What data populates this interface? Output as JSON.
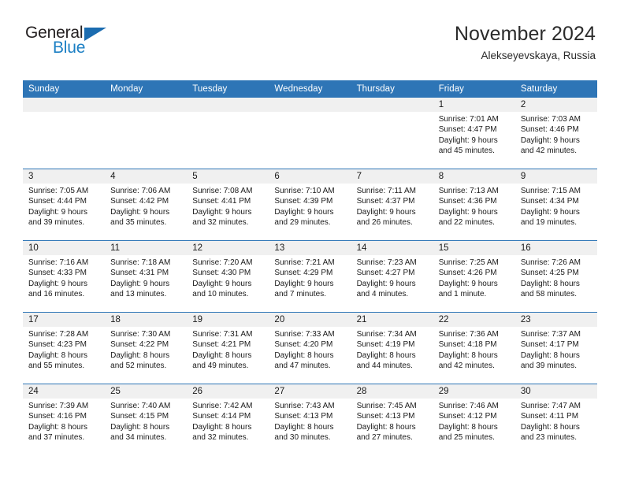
{
  "logo": {
    "word1": "General",
    "word2": "Blue",
    "triangle_icon": "triangle-icon",
    "color_dark": "#231f20",
    "color_blue": "#1b7fc4"
  },
  "header": {
    "title": "November 2024",
    "subtitle": "Alekseyevskaya, Russia"
  },
  "colors": {
    "header_bar": "#2e75b6",
    "daynum_strip": "#f0f0f0",
    "cell_bg": "#ffffff",
    "text": "#1a1a1a"
  },
  "weekdays": [
    "Sunday",
    "Monday",
    "Tuesday",
    "Wednesday",
    "Thursday",
    "Friday",
    "Saturday"
  ],
  "labels": {
    "sunrise": "Sunrise:",
    "sunset": "Sunset:",
    "daylight": "Daylight:"
  },
  "weeks": [
    [
      {
        "day": "",
        "sunrise": "",
        "sunset": "",
        "daylight1": "",
        "daylight2": "",
        "empty": true
      },
      {
        "day": "",
        "sunrise": "",
        "sunset": "",
        "daylight1": "",
        "daylight2": "",
        "empty": true
      },
      {
        "day": "",
        "sunrise": "",
        "sunset": "",
        "daylight1": "",
        "daylight2": "",
        "empty": true
      },
      {
        "day": "",
        "sunrise": "",
        "sunset": "",
        "daylight1": "",
        "daylight2": "",
        "empty": true
      },
      {
        "day": "",
        "sunrise": "",
        "sunset": "",
        "daylight1": "",
        "daylight2": "",
        "empty": true
      },
      {
        "day": "1",
        "sunrise": "Sunrise: 7:01 AM",
        "sunset": "Sunset: 4:47 PM",
        "daylight1": "Daylight: 9 hours",
        "daylight2": "and 45 minutes.",
        "empty": false
      },
      {
        "day": "2",
        "sunrise": "Sunrise: 7:03 AM",
        "sunset": "Sunset: 4:46 PM",
        "daylight1": "Daylight: 9 hours",
        "daylight2": "and 42 minutes.",
        "empty": false
      }
    ],
    [
      {
        "day": "3",
        "sunrise": "Sunrise: 7:05 AM",
        "sunset": "Sunset: 4:44 PM",
        "daylight1": "Daylight: 9 hours",
        "daylight2": "and 39 minutes.",
        "empty": false
      },
      {
        "day": "4",
        "sunrise": "Sunrise: 7:06 AM",
        "sunset": "Sunset: 4:42 PM",
        "daylight1": "Daylight: 9 hours",
        "daylight2": "and 35 minutes.",
        "empty": false
      },
      {
        "day": "5",
        "sunrise": "Sunrise: 7:08 AM",
        "sunset": "Sunset: 4:41 PM",
        "daylight1": "Daylight: 9 hours",
        "daylight2": "and 32 minutes.",
        "empty": false
      },
      {
        "day": "6",
        "sunrise": "Sunrise: 7:10 AM",
        "sunset": "Sunset: 4:39 PM",
        "daylight1": "Daylight: 9 hours",
        "daylight2": "and 29 minutes.",
        "empty": false
      },
      {
        "day": "7",
        "sunrise": "Sunrise: 7:11 AM",
        "sunset": "Sunset: 4:37 PM",
        "daylight1": "Daylight: 9 hours",
        "daylight2": "and 26 minutes.",
        "empty": false
      },
      {
        "day": "8",
        "sunrise": "Sunrise: 7:13 AM",
        "sunset": "Sunset: 4:36 PM",
        "daylight1": "Daylight: 9 hours",
        "daylight2": "and 22 minutes.",
        "empty": false
      },
      {
        "day": "9",
        "sunrise": "Sunrise: 7:15 AM",
        "sunset": "Sunset: 4:34 PM",
        "daylight1": "Daylight: 9 hours",
        "daylight2": "and 19 minutes.",
        "empty": false
      }
    ],
    [
      {
        "day": "10",
        "sunrise": "Sunrise: 7:16 AM",
        "sunset": "Sunset: 4:33 PM",
        "daylight1": "Daylight: 9 hours",
        "daylight2": "and 16 minutes.",
        "empty": false
      },
      {
        "day": "11",
        "sunrise": "Sunrise: 7:18 AM",
        "sunset": "Sunset: 4:31 PM",
        "daylight1": "Daylight: 9 hours",
        "daylight2": "and 13 minutes.",
        "empty": false
      },
      {
        "day": "12",
        "sunrise": "Sunrise: 7:20 AM",
        "sunset": "Sunset: 4:30 PM",
        "daylight1": "Daylight: 9 hours",
        "daylight2": "and 10 minutes.",
        "empty": false
      },
      {
        "day": "13",
        "sunrise": "Sunrise: 7:21 AM",
        "sunset": "Sunset: 4:29 PM",
        "daylight1": "Daylight: 9 hours",
        "daylight2": "and 7 minutes.",
        "empty": false
      },
      {
        "day": "14",
        "sunrise": "Sunrise: 7:23 AM",
        "sunset": "Sunset: 4:27 PM",
        "daylight1": "Daylight: 9 hours",
        "daylight2": "and 4 minutes.",
        "empty": false
      },
      {
        "day": "15",
        "sunrise": "Sunrise: 7:25 AM",
        "sunset": "Sunset: 4:26 PM",
        "daylight1": "Daylight: 9 hours",
        "daylight2": "and 1 minute.",
        "empty": false
      },
      {
        "day": "16",
        "sunrise": "Sunrise: 7:26 AM",
        "sunset": "Sunset: 4:25 PM",
        "daylight1": "Daylight: 8 hours",
        "daylight2": "and 58 minutes.",
        "empty": false
      }
    ],
    [
      {
        "day": "17",
        "sunrise": "Sunrise: 7:28 AM",
        "sunset": "Sunset: 4:23 PM",
        "daylight1": "Daylight: 8 hours",
        "daylight2": "and 55 minutes.",
        "empty": false
      },
      {
        "day": "18",
        "sunrise": "Sunrise: 7:30 AM",
        "sunset": "Sunset: 4:22 PM",
        "daylight1": "Daylight: 8 hours",
        "daylight2": "and 52 minutes.",
        "empty": false
      },
      {
        "day": "19",
        "sunrise": "Sunrise: 7:31 AM",
        "sunset": "Sunset: 4:21 PM",
        "daylight1": "Daylight: 8 hours",
        "daylight2": "and 49 minutes.",
        "empty": false
      },
      {
        "day": "20",
        "sunrise": "Sunrise: 7:33 AM",
        "sunset": "Sunset: 4:20 PM",
        "daylight1": "Daylight: 8 hours",
        "daylight2": "and 47 minutes.",
        "empty": false
      },
      {
        "day": "21",
        "sunrise": "Sunrise: 7:34 AM",
        "sunset": "Sunset: 4:19 PM",
        "daylight1": "Daylight: 8 hours",
        "daylight2": "and 44 minutes.",
        "empty": false
      },
      {
        "day": "22",
        "sunrise": "Sunrise: 7:36 AM",
        "sunset": "Sunset: 4:18 PM",
        "daylight1": "Daylight: 8 hours",
        "daylight2": "and 42 minutes.",
        "empty": false
      },
      {
        "day": "23",
        "sunrise": "Sunrise: 7:37 AM",
        "sunset": "Sunset: 4:17 PM",
        "daylight1": "Daylight: 8 hours",
        "daylight2": "and 39 minutes.",
        "empty": false
      }
    ],
    [
      {
        "day": "24",
        "sunrise": "Sunrise: 7:39 AM",
        "sunset": "Sunset: 4:16 PM",
        "daylight1": "Daylight: 8 hours",
        "daylight2": "and 37 minutes.",
        "empty": false
      },
      {
        "day": "25",
        "sunrise": "Sunrise: 7:40 AM",
        "sunset": "Sunset: 4:15 PM",
        "daylight1": "Daylight: 8 hours",
        "daylight2": "and 34 minutes.",
        "empty": false
      },
      {
        "day": "26",
        "sunrise": "Sunrise: 7:42 AM",
        "sunset": "Sunset: 4:14 PM",
        "daylight1": "Daylight: 8 hours",
        "daylight2": "and 32 minutes.",
        "empty": false
      },
      {
        "day": "27",
        "sunrise": "Sunrise: 7:43 AM",
        "sunset": "Sunset: 4:13 PM",
        "daylight1": "Daylight: 8 hours",
        "daylight2": "and 30 minutes.",
        "empty": false
      },
      {
        "day": "28",
        "sunrise": "Sunrise: 7:45 AM",
        "sunset": "Sunset: 4:13 PM",
        "daylight1": "Daylight: 8 hours",
        "daylight2": "and 27 minutes.",
        "empty": false
      },
      {
        "day": "29",
        "sunrise": "Sunrise: 7:46 AM",
        "sunset": "Sunset: 4:12 PM",
        "daylight1": "Daylight: 8 hours",
        "daylight2": "and 25 minutes.",
        "empty": false
      },
      {
        "day": "30",
        "sunrise": "Sunrise: 7:47 AM",
        "sunset": "Sunset: 4:11 PM",
        "daylight1": "Daylight: 8 hours",
        "daylight2": "and 23 minutes.",
        "empty": false
      }
    ]
  ]
}
